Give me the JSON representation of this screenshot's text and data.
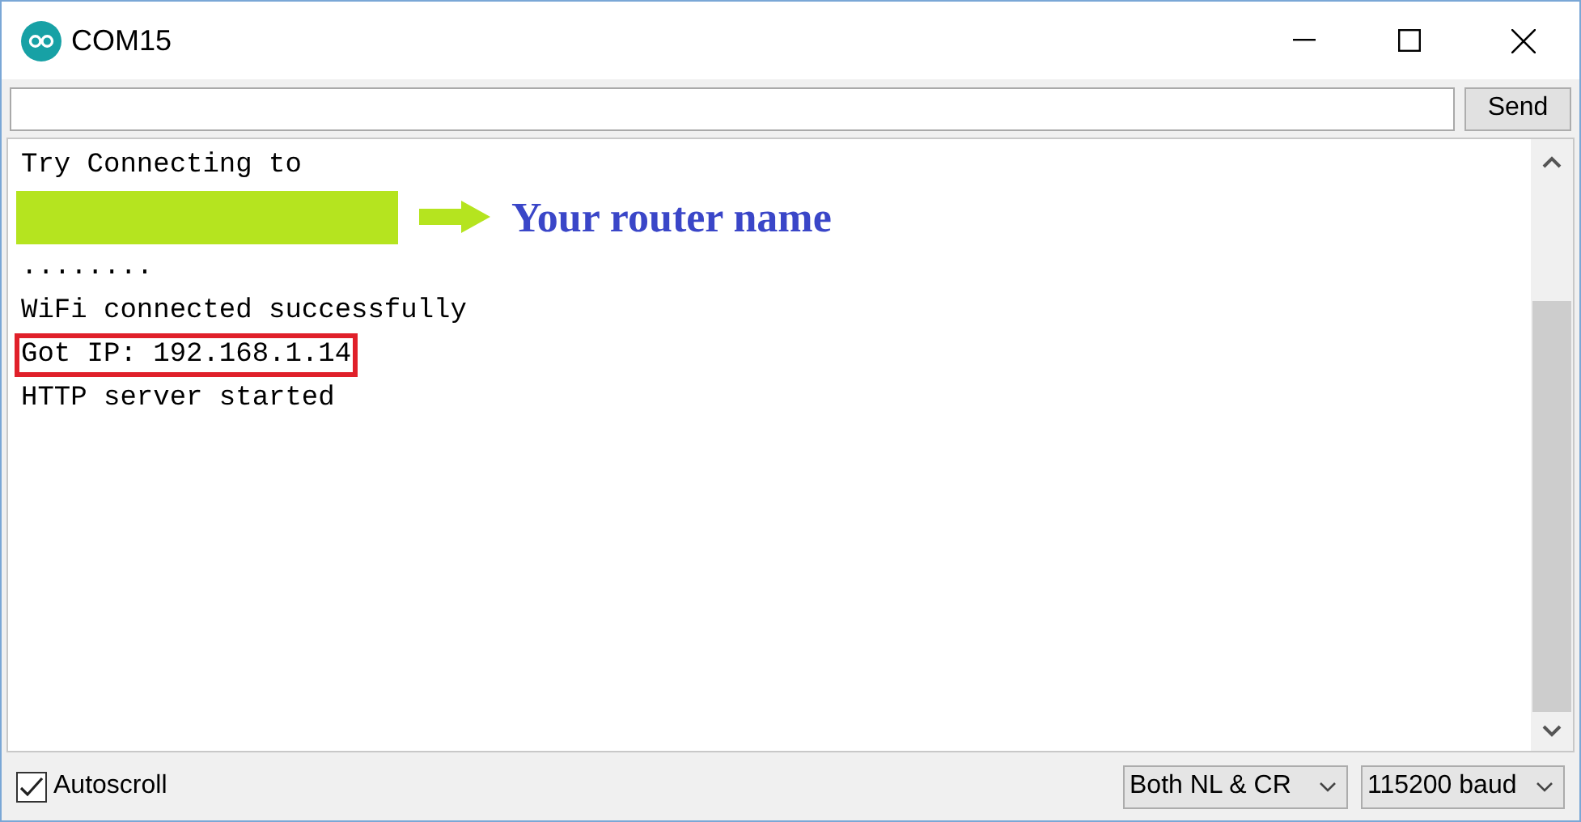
{
  "window": {
    "title": "COM15"
  },
  "send_button": "Send",
  "output": [
    {
      "kind": "text",
      "text": "Try Connecting to"
    },
    {
      "kind": "redacted",
      "annotation": "Your router name"
    },
    {
      "kind": "text",
      "text": "........"
    },
    {
      "kind": "text",
      "text": "WiFi connected successfully"
    },
    {
      "kind": "boxed",
      "text": "Got IP: 192.168.1.14"
    },
    {
      "kind": "text",
      "text": "HTTP server started"
    }
  ],
  "autoscroll": {
    "label": "Autoscroll",
    "checked": true
  },
  "line_ending": "Both NL & CR",
  "baud": "115200 baud"
}
